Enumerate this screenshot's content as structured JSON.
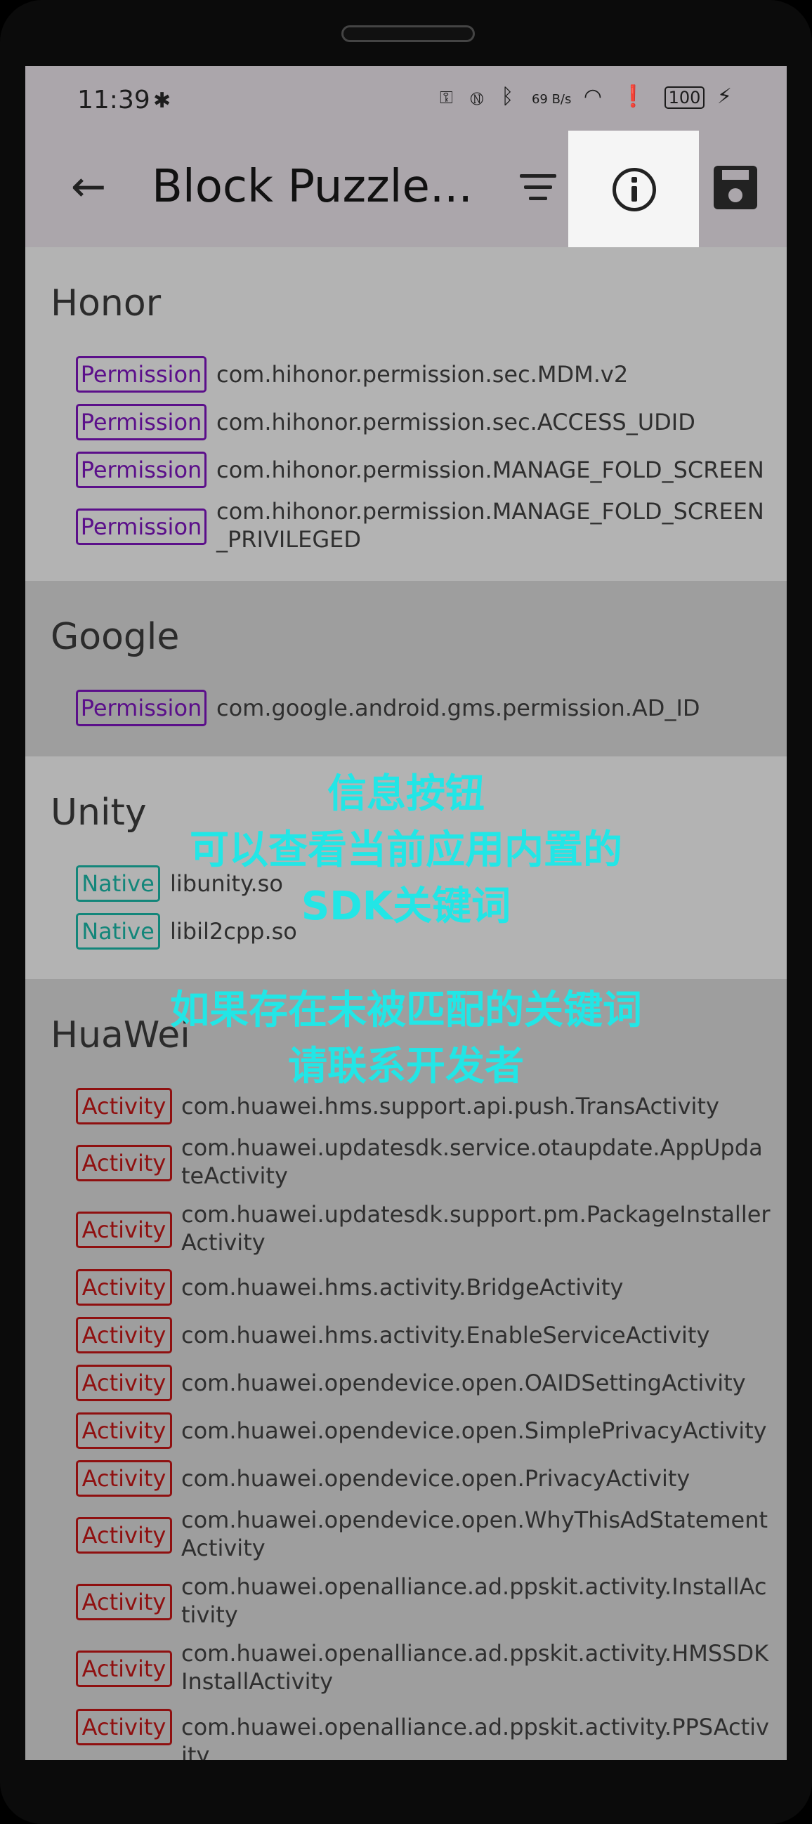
{
  "status": {
    "time": "11:39",
    "speed": "69 B/s",
    "battery": "100"
  },
  "app_bar": {
    "title": "Block Puzzle..."
  },
  "sections": [
    {
      "title": "Honor",
      "items": [
        {
          "tag": "Permission",
          "text": "com.hihonor.permission.sec.MDM.v2"
        },
        {
          "tag": "Permission",
          "text": "com.hihonor.permission.sec.ACCESS_UDID"
        },
        {
          "tag": "Permission",
          "text": "com.hihonor.permission.MANAGE_FOLD_SCREEN"
        },
        {
          "tag": "Permission",
          "text": "com.hihonor.permission.MANAGE_FOLD_SCREEN_PRIVILEGED"
        }
      ]
    },
    {
      "title": "Google",
      "items": [
        {
          "tag": "Permission",
          "text": "com.google.android.gms.permission.AD_ID"
        }
      ]
    },
    {
      "title": "Unity",
      "items": [
        {
          "tag": "Native",
          "text": "libunity.so"
        },
        {
          "tag": "Native",
          "text": "libil2cpp.so"
        }
      ]
    },
    {
      "title": "HuaWei",
      "items": [
        {
          "tag": "Activity",
          "text": "com.huawei.hms.support.api.push.TransActivity"
        },
        {
          "tag": "Activity",
          "text": "com.huawei.updatesdk.service.otaupdate.AppUpdateActivity"
        },
        {
          "tag": "Activity",
          "text": "com.huawei.updatesdk.support.pm.PackageInstallerActivity"
        },
        {
          "tag": "Activity",
          "text": "com.huawei.hms.activity.BridgeActivity"
        },
        {
          "tag": "Activity",
          "text": "com.huawei.hms.activity.EnableServiceActivity"
        },
        {
          "tag": "Activity",
          "text": "com.huawei.opendevice.open.OAIDSettingActivity"
        },
        {
          "tag": "Activity",
          "text": "com.huawei.opendevice.open.SimplePrivacyActivity"
        },
        {
          "tag": "Activity",
          "text": "com.huawei.opendevice.open.PrivacyActivity"
        },
        {
          "tag": "Activity",
          "text": "com.huawei.opendevice.open.WhyThisAdStatementActivity"
        },
        {
          "tag": "Activity",
          "text": "com.huawei.openalliance.ad.ppskit.activity.InstallActivity"
        },
        {
          "tag": "Activity",
          "text": "com.huawei.openalliance.ad.ppskit.activity.HMSSDKInstallActivity"
        },
        {
          "tag": "Activity",
          "text": "com.huawei.openalliance.ad.ppskit.activity.PPSActivity"
        }
      ]
    }
  ],
  "overlay": {
    "line1": "信息按钮",
    "line2": "可以查看当前应用内置的",
    "line3": "SDK关键词",
    "line4": "如果存在未被匹配的关键词",
    "line5": "请联系开发者"
  },
  "colors": {
    "permission": "#5b0f8a",
    "native": "#13867a",
    "activity": "#8f1010",
    "overlay": "#22e6e6"
  }
}
